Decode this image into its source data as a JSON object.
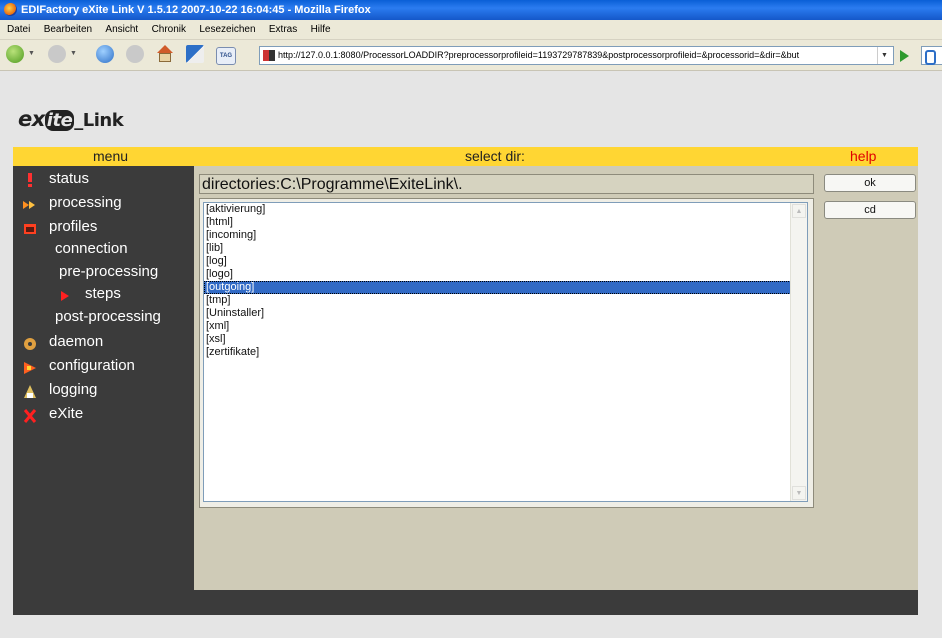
{
  "window": {
    "title": "EDIFactory eXite Link V 1.5.12 2007-10-22 16:04:45 - Mozilla Firefox"
  },
  "menubar": [
    "Datei",
    "Bearbeiten",
    "Ansicht",
    "Chronik",
    "Lesezeichen",
    "Extras",
    "Hilfe"
  ],
  "toolbar": {
    "url": "http://127.0.0.1:8080/ProcessorLOADDIR?preprocessorprofileid=1193729787839&postprocessorprofileid=&processorid=&dir=&but",
    "tag_label": "TAG",
    "dropdown_glyph": "▼"
  },
  "logo": {
    "part1": "ex",
    "part2": "ite",
    "part3": "_Link"
  },
  "header": {
    "menu": "menu",
    "select": "select dir:",
    "help": "help"
  },
  "sidebar": {
    "items": [
      {
        "label": "status",
        "icon": "exclamation-icon",
        "color": "#ff3030"
      },
      {
        "label": "processing",
        "icon": "arrows-icon",
        "color": "#ff9020"
      },
      {
        "label": "profiles",
        "icon": "profile-icon",
        "color": "#ff4020"
      },
      {
        "label": "connection"
      },
      {
        "label": "pre-processing"
      },
      {
        "label": "steps",
        "icon": "triangle-right-icon",
        "color": "#ff2020"
      },
      {
        "label": "post-processing"
      },
      {
        "label": "daemon",
        "icon": "daemon-icon",
        "color": "#e0a040"
      },
      {
        "label": "configuration",
        "icon": "config-icon",
        "color": "#ff6020"
      },
      {
        "label": "logging",
        "icon": "logging-icon",
        "color": "#e0c060"
      },
      {
        "label": "eXite",
        "icon": "x-icon",
        "color": "#ff2020"
      }
    ]
  },
  "content": {
    "directories_label": "directories:C:\\Programme\\ExiteLink\\.",
    "directories": [
      "[aktivierung]",
      "[html]",
      "[incoming]",
      "[lib]",
      "[log]",
      "[logo]",
      "[outgoing]",
      "[tmp]",
      "[Uninstaller]",
      "[xml]",
      "[xsl]",
      "[zertifikate]"
    ],
    "selected_index": 6,
    "ok_label": "ok",
    "cd_label": "cd"
  },
  "colors": {
    "accent": "#ffd633",
    "panel": "#3b3b3b",
    "content_bg": "#cfcbb7",
    "help": "#e00000",
    "selection": "#316ac5"
  }
}
